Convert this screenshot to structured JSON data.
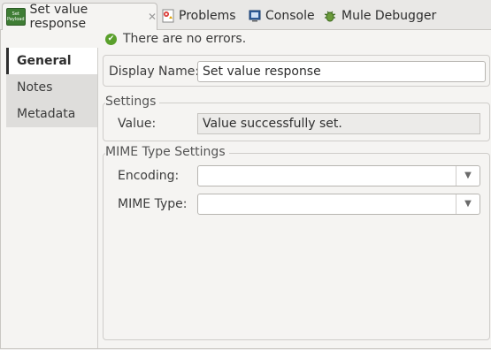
{
  "tabs": [
    {
      "label": "Set value response",
      "icon": "set-payload-icon",
      "icon_text": "Set Payload",
      "active": true
    },
    {
      "label": "Problems",
      "icon": "problems-icon"
    },
    {
      "label": "Console",
      "icon": "console-icon"
    },
    {
      "label": "Mule Debugger",
      "icon": "debugger-icon"
    }
  ],
  "status": {
    "text": "There are no errors.",
    "icon": "check-icon"
  },
  "nav": [
    "General",
    "Notes",
    "Metadata"
  ],
  "form": {
    "display_name_label": "Display Name:",
    "display_name_value": "Set value response",
    "settings_title": "Settings",
    "value_label": "Value:",
    "value_value": "Value successfully set.",
    "mime_title": "MIME Type Settings",
    "encoding_label": "Encoding:",
    "encoding_value": "",
    "mime_label": "MIME Type:",
    "mime_value": ""
  },
  "colors": {
    "status_ok": "#5aa02c",
    "payload_icon": "#3f7d35"
  }
}
